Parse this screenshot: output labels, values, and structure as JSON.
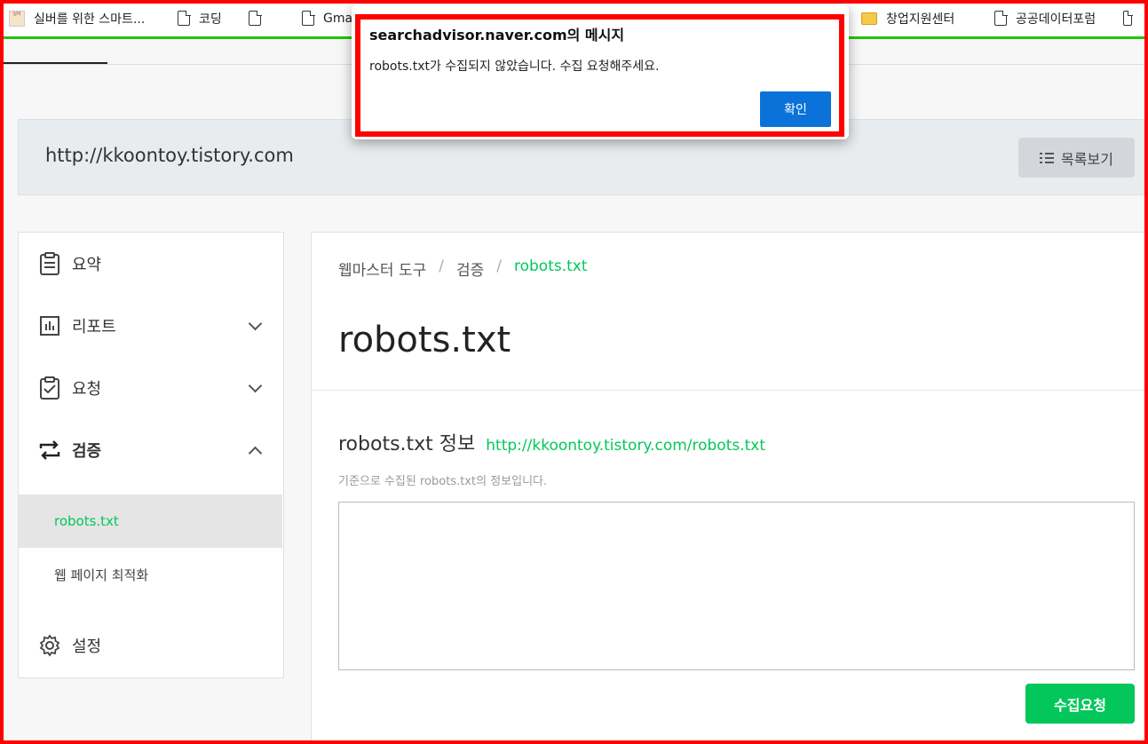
{
  "bookmarks": [
    {
      "label": "실버를 위한 스마트...",
      "icon": "favicon-icon"
    },
    {
      "label": "코딩",
      "icon": "page-icon"
    },
    {
      "label": "",
      "icon": "page-icon"
    },
    {
      "label": "Gmail",
      "icon": "page-icon"
    },
    {
      "label": "창업지원센터",
      "icon": "folder-icon"
    },
    {
      "label": "공공데이터포럼",
      "icon": "page-icon"
    },
    {
      "label": "",
      "icon": "page-icon"
    }
  ],
  "site": {
    "url": "http://kkoontoy.tistory.com",
    "list_button": "목록보기"
  },
  "sidebar": {
    "items": [
      {
        "label": "요약",
        "icon": "clipboard-icon"
      },
      {
        "label": "리포트",
        "icon": "bar-chart-icon"
      },
      {
        "label": "요청",
        "icon": "clipboard-check-icon"
      },
      {
        "label": "검증",
        "icon": "swap-arrows-icon"
      },
      {
        "label": "설정",
        "icon": "gear-icon"
      }
    ],
    "sub_items": [
      {
        "label": "robots.txt",
        "active": true
      },
      {
        "label": "웹 페이지 최적화",
        "active": false
      }
    ]
  },
  "main": {
    "breadcrumb": [
      "웹마스터 도구",
      "검증",
      "robots.txt"
    ],
    "breadcrumb_sep": "/",
    "title": "robots.txt",
    "section_title": "robots.txt 정보",
    "section_url": "http://kkoontoy.tistory.com/robots.txt",
    "description": "기준으로 수집된 robots.txt의 정보입니다.",
    "textarea_value": "",
    "request_button": "수집요청"
  },
  "dialog": {
    "title": "searchadvisor.naver.com의 메시지",
    "message": "robots.txt가 수집되지 않았습니다. 수집 요청해주세요.",
    "ok_button": "확인"
  },
  "colors": {
    "accent_green": "#03c75a",
    "dialog_button": "#0b72d9",
    "highlight_frame": "#ff0000"
  }
}
